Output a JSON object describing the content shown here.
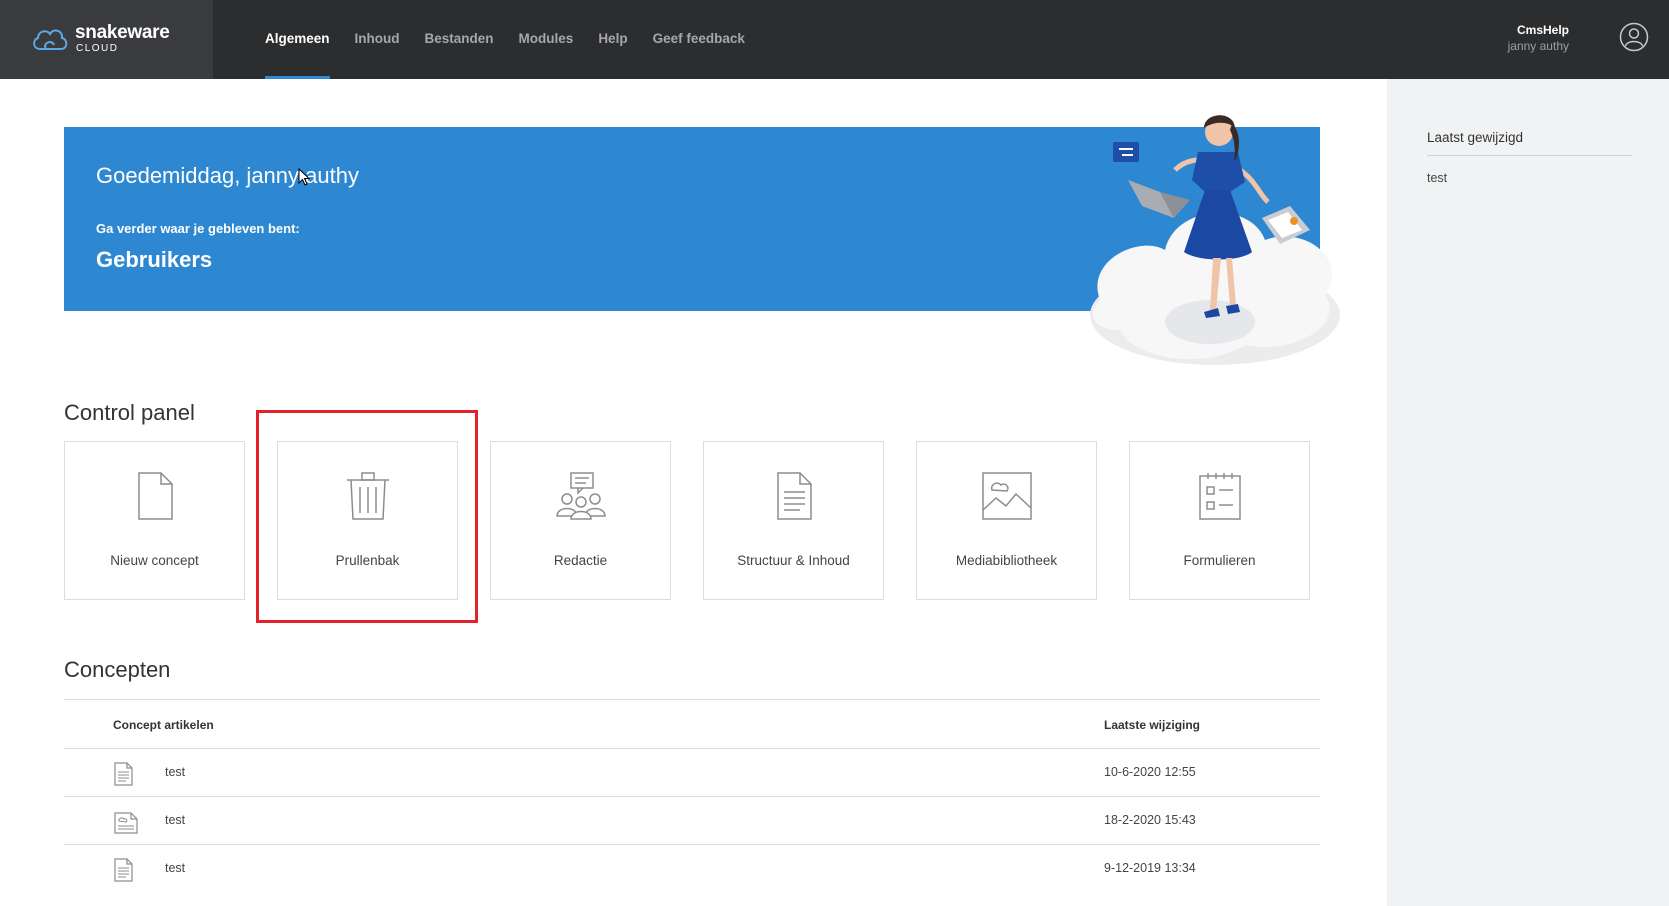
{
  "brand": {
    "name": "snakeware",
    "sub": "CLOUD"
  },
  "nav": [
    {
      "label": "Algemeen",
      "active": true
    },
    {
      "label": "Inhoud"
    },
    {
      "label": "Bestanden"
    },
    {
      "label": "Modules"
    },
    {
      "label": "Help"
    },
    {
      "label": "Geef feedback"
    }
  ],
  "user": {
    "app": "CmsHelp",
    "name": "janny authy"
  },
  "banner": {
    "greeting": "Goedemiddag, janny authy",
    "continue_label": "Ga verder waar je gebleven bent:",
    "continue_link": "Gebruikers"
  },
  "control_panel": {
    "title": "Control panel",
    "tiles": [
      {
        "label": "Nieuw concept",
        "icon": "new-document-icon"
      },
      {
        "label": "Prullenbak",
        "icon": "trash-icon"
      },
      {
        "label": "Redactie",
        "icon": "editorial-team-icon"
      },
      {
        "label": "Structuur & Inhoud",
        "icon": "structure-document-icon"
      },
      {
        "label": "Mediabibliotheek",
        "icon": "image-icon"
      },
      {
        "label": "Formulieren",
        "icon": "form-icon"
      }
    ]
  },
  "concepten": {
    "title": "Concepten",
    "columns": [
      "Concept artikelen",
      "Laatste wijziging"
    ],
    "rows": [
      {
        "name": "test",
        "date": "10-6-2020 12:55",
        "icon": "document-icon"
      },
      {
        "name": "test",
        "date": "18-2-2020 15:43",
        "icon": "image-document-icon"
      },
      {
        "name": "test",
        "date": "9-12-2019 13:34",
        "icon": "document-icon"
      }
    ]
  },
  "sidebar": {
    "title": "Laatst gewijzigd",
    "items": [
      "test"
    ]
  },
  "colors": {
    "accent": "#2e87d1",
    "topbar": "#2c2d2f",
    "highlight": "#e2222a"
  }
}
